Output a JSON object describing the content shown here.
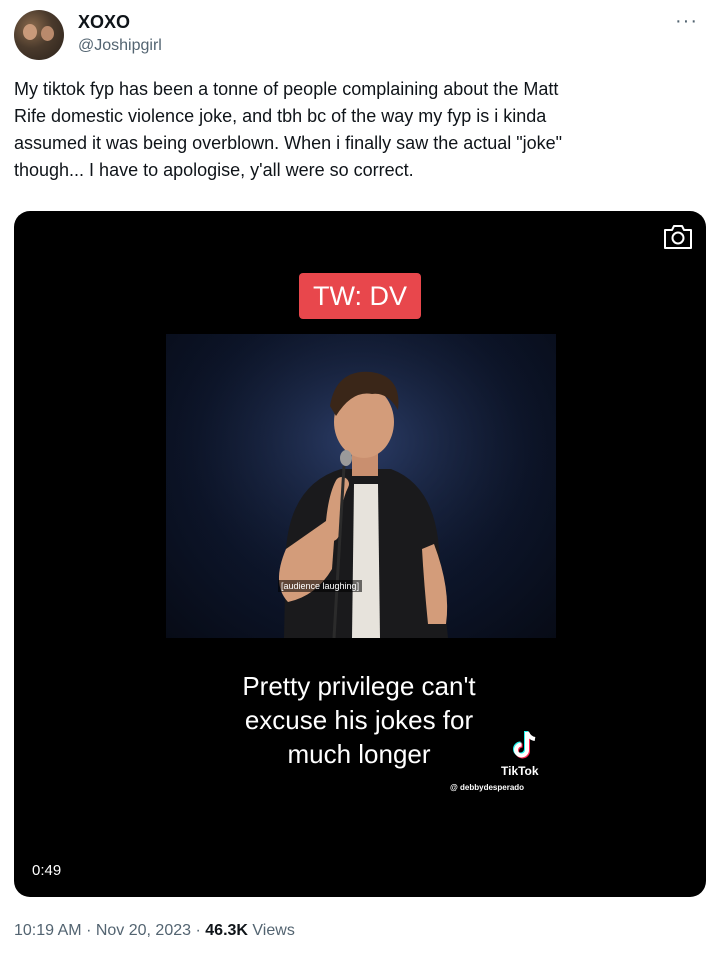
{
  "author": {
    "name": "XOXO",
    "handle": "@Joshipgirl"
  },
  "more_label": "···",
  "tweet_text": [
    "My tiktok fyp has been a tonne of people complaining about the Matt",
    "Rife domestic violence joke, and tbh bc of the way my fyp is i kinda",
    "assumed it was being overblown. When i finally saw the actual \"joke\"",
    "though... I have to apologise, y'all were so correct."
  ],
  "media": {
    "badge": "TW: DV",
    "subtitle": "[audience laughing]",
    "overlay_text": [
      "Pretty privilege can't",
      "excuse his jokes for",
      "much longer"
    ],
    "watermark_brand": "TikTok",
    "watermark_user": "@ debbydesperado",
    "duration": "0:49",
    "icons": {
      "camera": "camera-icon",
      "tiktok": "tiktok-logo-icon"
    }
  },
  "meta": {
    "time": "10:19 AM",
    "date": "Nov 20, 2023",
    "separator": "·",
    "views_count": "46.3K",
    "views_label": "Views"
  }
}
